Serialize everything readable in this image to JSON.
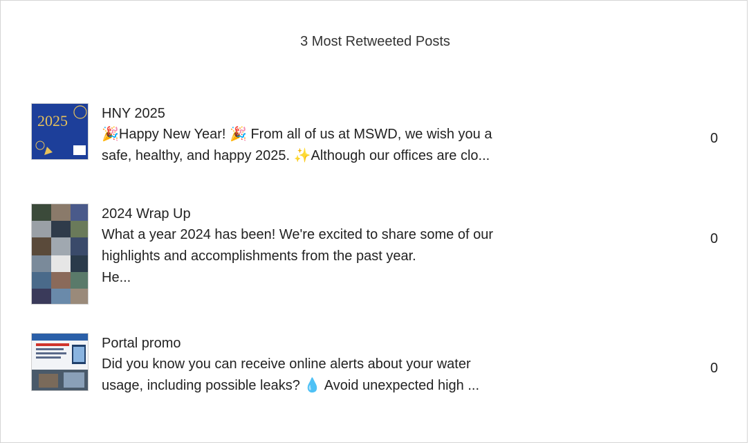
{
  "header": {
    "title": "3 Most Retweeted Posts"
  },
  "posts": [
    {
      "title": "HNY 2025",
      "body": "🎉Happy New Year! 🎉 From all of us at MSWD, we wish you a\nsafe, healthy, and happy 2025. ✨Although our offices are clo...",
      "count": "0",
      "thumb_text": "2025"
    },
    {
      "title": "2024 Wrap Up",
      "body": "What a year 2024 has been! We're excited to share some of our\nhighlights and accomplishments from the past year.\nHe...",
      "count": "0"
    },
    {
      "title": "Portal promo",
      "body": "Did you know you can receive online alerts about your water\nusage, including possible leaks? 💧 Avoid unexpected high ...",
      "count": "0"
    }
  ]
}
